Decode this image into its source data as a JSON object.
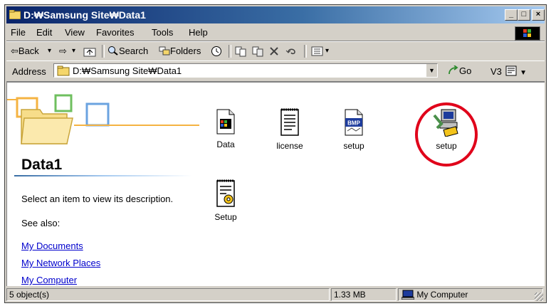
{
  "window": {
    "title": "D:\\Samsung Site\\Data1",
    "title_display": "D:₩Samsung Site₩Data1",
    "controls": [
      "_",
      "□",
      "×"
    ]
  },
  "menu": {
    "items": [
      "File",
      "Edit",
      "View",
      "Favorites",
      "Tools",
      "Help"
    ]
  },
  "toolbar": {
    "back": "⇦Back",
    "back_arrow": "▾",
    "forward": "⇨",
    "forward_arrow": "▾",
    "search": "Search",
    "folders": "Folders",
    "views_arrow": "▾"
  },
  "address": {
    "label": "Address",
    "value": "D:₩Samsung Site₩Data1",
    "go": "Go",
    "extra": "V3"
  },
  "left_pane": {
    "folder_title": "Data1",
    "description": "Select an item to view its description.",
    "see_also": "See also:",
    "links": [
      "My Documents",
      "My Network Places",
      "My Computer"
    ]
  },
  "files": [
    {
      "name": "Data",
      "icon": "file-icon"
    },
    {
      "name": "license",
      "icon": "text-document-icon"
    },
    {
      "name": "setup",
      "icon": "bitmap-icon"
    },
    {
      "name": "setup",
      "icon": "setup-installer-icon",
      "highlighted": true
    },
    {
      "name": "Setup",
      "icon": "config-settings-icon"
    }
  ],
  "status": {
    "objects": "5 object(s)",
    "size": "1.33 MB",
    "location": "My Computer"
  },
  "colors": {
    "title_gradient_start": "#0a246a",
    "title_gradient_end": "#a6caf0",
    "highlight_circle": "#e0001a",
    "link": "#0000cc"
  }
}
